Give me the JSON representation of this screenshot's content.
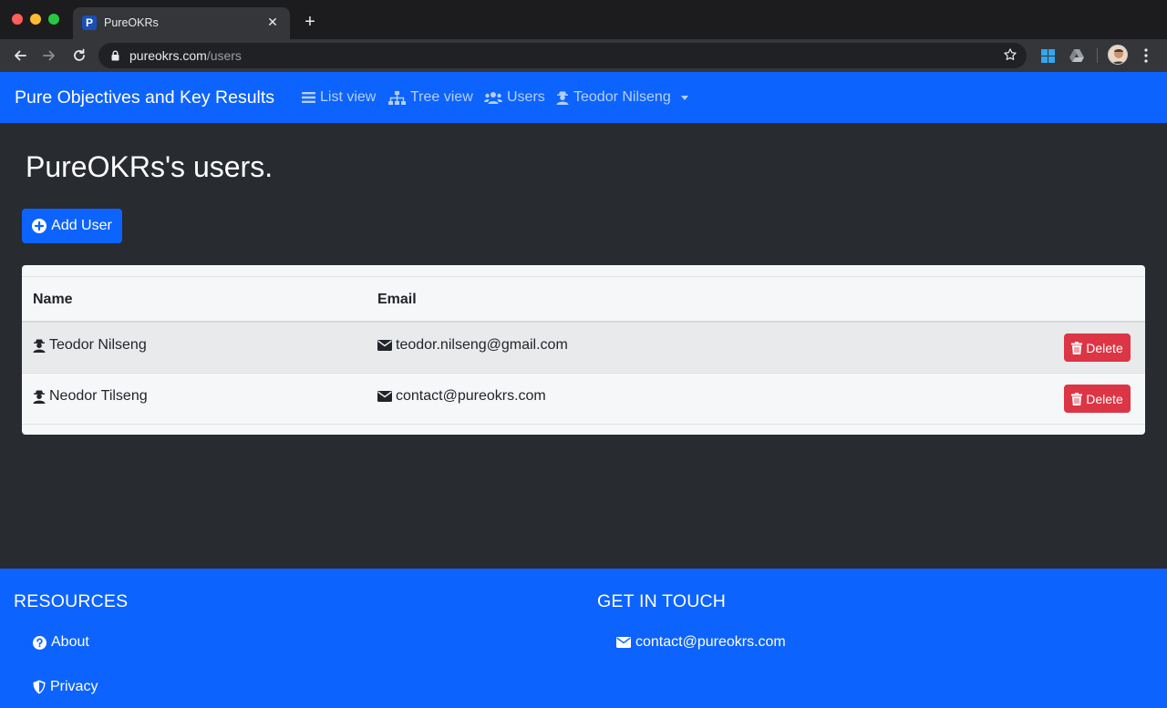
{
  "browser": {
    "tab_title": "PureOKRs",
    "tab_favicon_letter": "P",
    "url_host": "pureokrs.com",
    "url_path": "/users"
  },
  "navbar": {
    "brand": "Pure Objectives and Key Results",
    "links": [
      {
        "label": "List view",
        "icon": "list-icon"
      },
      {
        "label": "Tree view",
        "icon": "sitemap-icon"
      },
      {
        "label": "Users",
        "icon": "users-icon"
      },
      {
        "label": "Teodor Nilseng",
        "icon": "user-secret-icon"
      }
    ],
    "link_color": "#b4d0fb",
    "accent": "#0d63fd"
  },
  "main": {
    "title": "PureOKRs's users.",
    "add_button": "Add User",
    "table": {
      "columns": [
        "Name",
        "Email"
      ],
      "rows": [
        {
          "name": "Teodor Nilseng",
          "email": "teodor.nilseng@gmail.com",
          "action": "Delete"
        },
        {
          "name": "Neodor Tilseng",
          "email": "contact@pureokrs.com",
          "action": "Delete"
        }
      ]
    },
    "danger_color": "#dc3545"
  },
  "footer": {
    "resources_heading": "RESOURCES",
    "resources": [
      {
        "label": "About",
        "icon": "question-circle-icon"
      },
      {
        "label": "Privacy",
        "icon": "shield-icon"
      }
    ],
    "contact_heading": "GET IN TOUCH",
    "contact_email": "contact@pureokrs.com"
  }
}
